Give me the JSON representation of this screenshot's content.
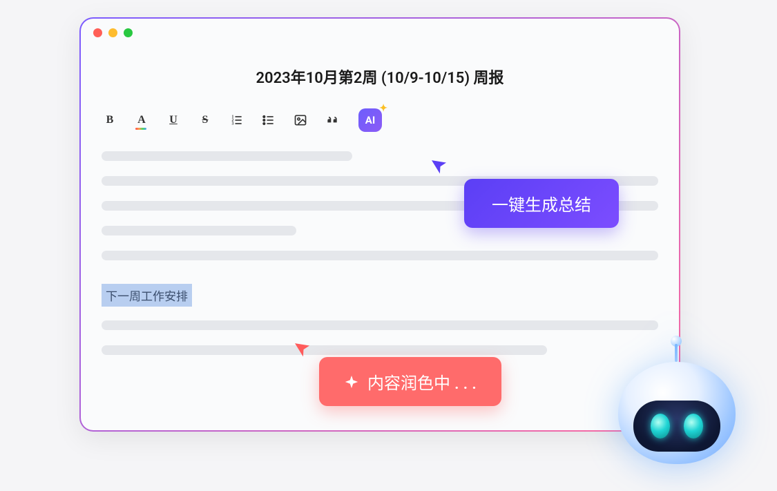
{
  "window": {
    "title": "2023年10月第2周 (10/9-10/15) 周报"
  },
  "toolbar": {
    "bold": "B",
    "color": "A",
    "underline": "U",
    "strike": "S",
    "ai_label": "AI"
  },
  "content": {
    "highlighted_text": "下一周工作安排"
  },
  "tooltips": {
    "purple": "一键生成总结",
    "red": "内容润色中 . . ."
  },
  "colors": {
    "purple": "#5b3ff5",
    "red": "#ff6b6b",
    "highlight_bg": "#b8cef0"
  }
}
